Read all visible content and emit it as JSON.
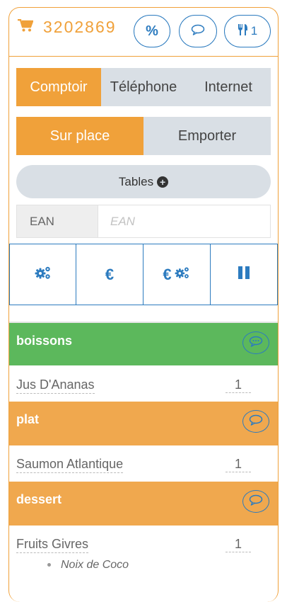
{
  "header": {
    "order_number": "3202869",
    "discount_label": "%",
    "covers_count": "1"
  },
  "channel": {
    "options": [
      "Comptoir",
      "Téléphone",
      "Internet"
    ],
    "selected": "Comptoir"
  },
  "service": {
    "options": [
      "Sur place",
      "Emporter"
    ],
    "selected": "Sur place"
  },
  "tables_label": "Tables",
  "ean": {
    "label": "EAN",
    "placeholder": "EAN"
  },
  "actions": [
    "settings",
    "euro",
    "euro-settings",
    "pause"
  ],
  "colors": {
    "accent": "#f0a13a",
    "blue": "#2c7bbf",
    "green": "#5cb85c",
    "gray": "#d9dfe5"
  },
  "categories": [
    {
      "name": "boissons",
      "color": "green",
      "items": [
        {
          "name": "Jus D'Ananas",
          "qty": "1"
        }
      ]
    },
    {
      "name": "plat",
      "color": "orange",
      "items": [
        {
          "name": "Saumon Atlantique",
          "qty": "1"
        }
      ]
    },
    {
      "name": "dessert",
      "color": "orange",
      "items": [
        {
          "name": "Fruits Givres",
          "qty": "1",
          "options": [
            "Noix de Coco"
          ]
        }
      ]
    }
  ]
}
